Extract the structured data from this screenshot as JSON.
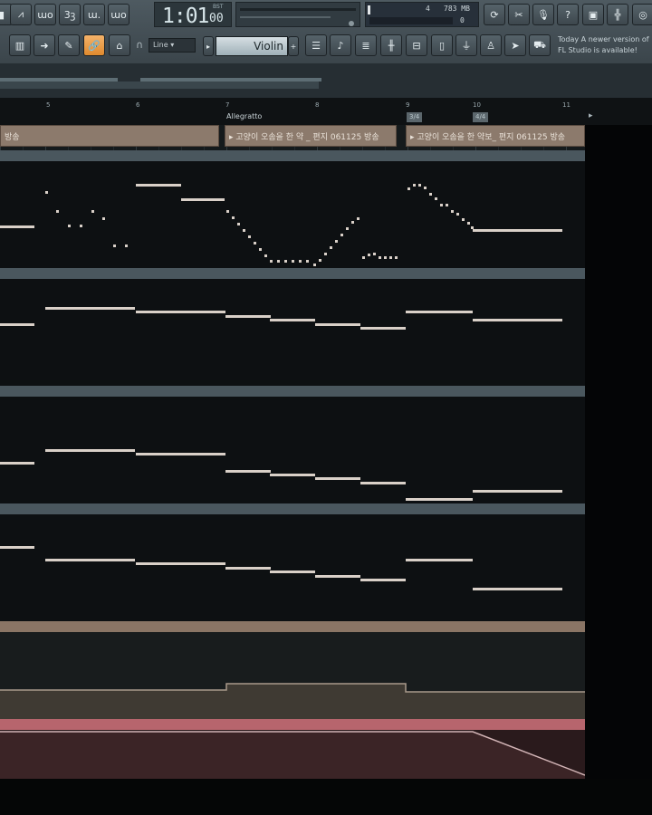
{
  "transport": {
    "time_main": "1:01",
    "time_ticks": "00",
    "time_mode": "BST"
  },
  "cpu": {
    "value1": "4",
    "memory": "783 MB",
    "value2": "0"
  },
  "tools": {
    "snap": "Line",
    "instrument": "Violin"
  },
  "news": {
    "text": "Today  A newer version of FL Studio is available!"
  },
  "timeline": {
    "bars": [
      "5",
      "6",
      "7",
      "8",
      "9",
      "10",
      "11"
    ],
    "tempo_marker": "Allegratto",
    "ts_marker_1": "3/4",
    "ts_marker_2": "4/4"
  },
  "clips": {
    "text_clip_1": "방송",
    "text_clip_2": "▸ 고양이 오솜을 한 약 _ 편지 061125 방송",
    "text_clip_3": "▸ 고양이 오솜을 한 약보_ 편지 061125 방송"
  },
  "colors": {
    "accent": "#e08a2e",
    "clip_header": "#4a575e",
    "note": "#d9d0c8",
    "text_clip": "#8c7a6c",
    "automation_pink": "#b7656d"
  },
  "icons": [
    "metronome-icon",
    "loop-record-icon",
    "countdown-icon",
    "step-edit-icon",
    "blend-icon",
    "piano-roll-icon",
    "arrow-icon",
    "pencil-icon",
    "link-icon",
    "stamp-icon",
    "magnet-icon",
    "undo-icon",
    "cut-icon",
    "microphone-icon",
    "help-icon",
    "save-icon",
    "mixer-icon",
    "chat-icon"
  ]
}
